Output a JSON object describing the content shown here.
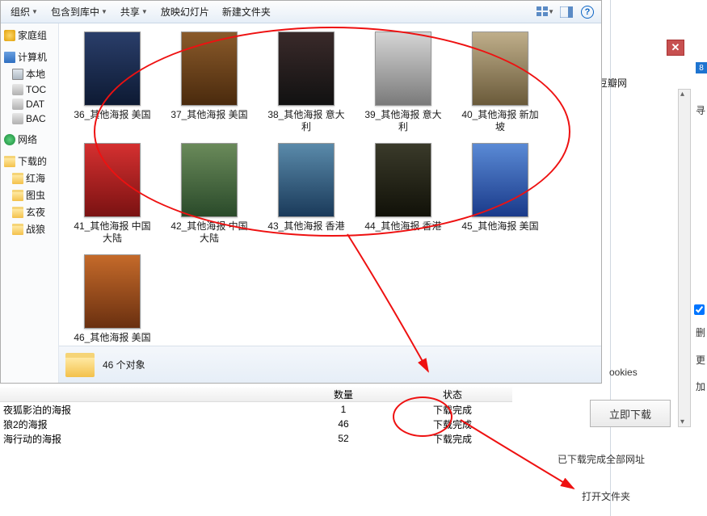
{
  "toolbar": {
    "organize": "组织",
    "include": "包含到库中",
    "share": "共享",
    "slideshow": "放映幻灯片",
    "new_folder": "新建文件夹"
  },
  "sidebar": {
    "homegroup": "家庭组",
    "computer": "计算机",
    "drives": [
      "本地",
      "TOC",
      "DAT",
      "BAC"
    ],
    "network": "网络",
    "downloads": {
      "label": "下载的",
      "folders": [
        "红海",
        "图虫",
        "玄夜",
        "战狼"
      ]
    }
  },
  "thumbs": [
    {
      "id": "p36",
      "label": "36_其他海报 美国"
    },
    {
      "id": "p37",
      "label": "37_其他海报 美国"
    },
    {
      "id": "p38",
      "label": "38_其他海报 意大利"
    },
    {
      "id": "p39",
      "label": "39_其他海报 意大利"
    },
    {
      "id": "p40",
      "label": "40_其他海报 新加坡"
    },
    {
      "id": "p41",
      "label": "41_其他海报 中国大陆"
    },
    {
      "id": "p42",
      "label": "42_其他海报 中国大陆"
    },
    {
      "id": "p43",
      "label": "43_其他海报 香港"
    },
    {
      "id": "p44",
      "label": "44_其他海报 香港"
    },
    {
      "id": "p45",
      "label": "45_其他海报 美国"
    },
    {
      "id": "p46",
      "label": "46_其他海报 美国"
    }
  ],
  "status": {
    "count_text": "46 个对象"
  },
  "right": {
    "browse": "浏览豆瓣网",
    "badge": "8",
    "cookies": "ookies",
    "label_search": "寻",
    "label_del": "删",
    "label_replace": "更",
    "label_add": "加"
  },
  "downloads_panel": {
    "btn": "立即下载",
    "complete_msg": "已下载完成全部网址",
    "open_folder": "打开文件夹"
  },
  "table": {
    "headers": {
      "qty": "数量",
      "status": "状态"
    },
    "rows": [
      {
        "name": "夜狐影泊的海报",
        "qty": "1",
        "status": "下载完成"
      },
      {
        "name": "狼2的海报",
        "qty": "46",
        "status": "下载完成"
      },
      {
        "name": "海行动的海报",
        "qty": "52",
        "status": "下载完成"
      }
    ]
  }
}
